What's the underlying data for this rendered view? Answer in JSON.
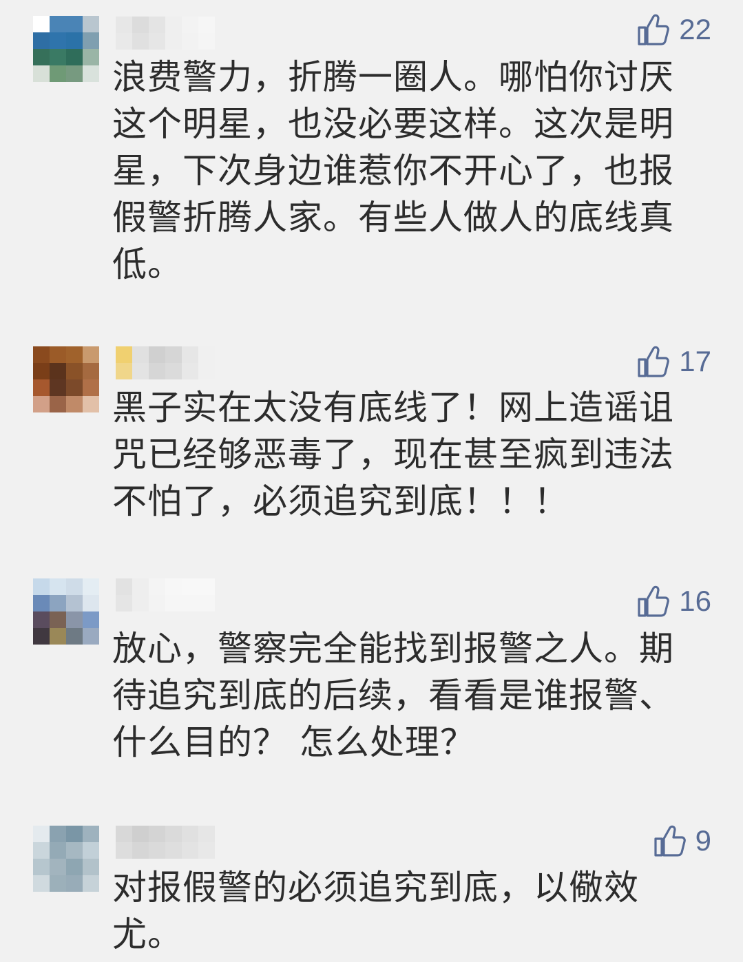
{
  "comments": [
    {
      "likes": "22",
      "text": "浪费警力，折腾一圈人。哪怕你讨厌\n这个明星，也没必要这样。这次是明\n星，下次身边谁惹你不开心了，也报\n假警折腾人家。有些人做人的底线真\n低。",
      "avatar_colors": [
        "#ffffff",
        "#4a84b6",
        "#4a84b6",
        "#b9c6cf",
        "#2e6ea4",
        "#2f74ac",
        "#2b72a8",
        "#7f9fb0",
        "#36705a",
        "#3a7a64",
        "#2f6d5a",
        "#9ab5a6",
        "#d8e0d8",
        "#6f9a76",
        "#779a80",
        "#d9e2dc"
      ],
      "nick_colors": [
        "#e7e7e7",
        "#dcdcdc",
        "#e4e4e4",
        "#efefef",
        "#f3f3f3",
        "#f6f6f6"
      ]
    },
    {
      "likes": "17",
      "text": "黑子实在太没有底线了！网上造谣诅\n咒已经够恶毒了，现在甚至疯到违法\n不怕了，必须追究到底！！！",
      "avatar_colors": [
        "#8a4a1e",
        "#9b5b28",
        "#a0622c",
        "#c99a6e",
        "#7a3e18",
        "#5b331c",
        "#8a5228",
        "#a56a40",
        "#a6582e",
        "#5e3622",
        "#7c4a2a",
        "#b07048",
        "#d2a088",
        "#9a6448",
        "#c08a68",
        "#e2c0a8"
      ],
      "nick_colors": [
        "#f0d070",
        "#e0e0e0",
        "#d0d0d0",
        "#d6d6d6",
        "#e6e6e6",
        "#f0f0f0"
      ]
    },
    {
      "likes": "16",
      "text": "放心，警察完全能找到报警之人。期\n待追究到底的后续，看看是谁报警、\n什么目的？ 怎么处理？",
      "avatar_colors": [
        "#c6d9ea",
        "#d6e4ef",
        "#cfdce8",
        "#e4edf3",
        "#6a8ab8",
        "#8ca4c0",
        "#b4c2d2",
        "#dde6ee",
        "#5a4c5e",
        "#7a6254",
        "#8a95a8",
        "#7c9ac6",
        "#403840",
        "#9a8858",
        "#6e7a84",
        "#9aaac0"
      ],
      "nick_colors": [
        "#e2e2e2",
        "#eeeeee",
        "#f4f4f4",
        "#f7f7f7",
        "#f8f8f8",
        "#f8f8f8"
      ]
    },
    {
      "likes": "9",
      "text": "对报假警的必须追究到底，以儆效\n尤。",
      "avatar_colors": [
        "#e4eaee",
        "#8aa2b0",
        "#7a96a6",
        "#9eb2be",
        "#cad6dc",
        "#94aab6",
        "#a6b8c2",
        "#c2d0d8",
        "#b6c6ce",
        "#a2b4be",
        "#8ea6b2",
        "#b2c2ca",
        "#d0dadf",
        "#9cb0ba",
        "#98acb8",
        "#c6d2d8"
      ],
      "nick_colors": [
        "#d8d8d8",
        "#cfcfcf",
        "#d4d4d4",
        "#dadada",
        "#e0e0e0",
        "#e6e6e6"
      ]
    }
  ]
}
